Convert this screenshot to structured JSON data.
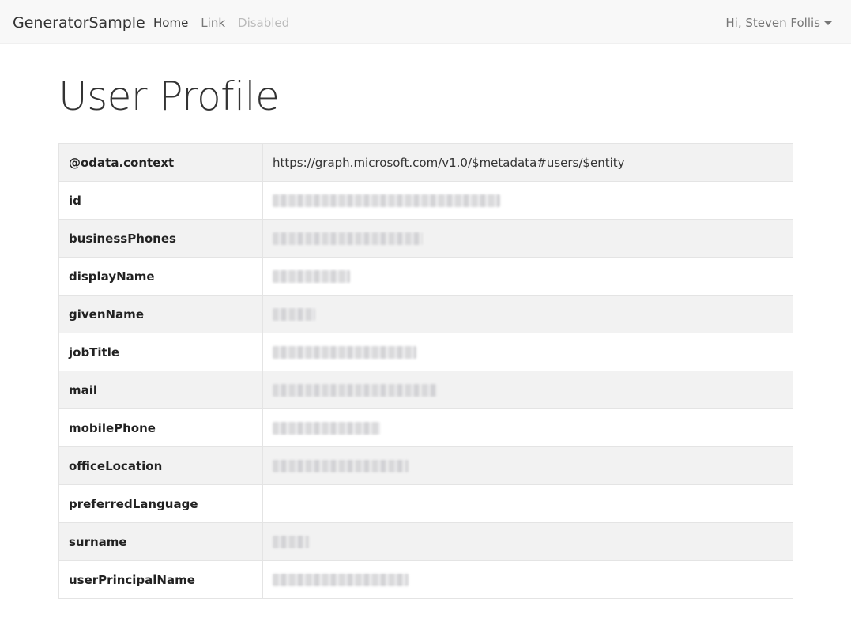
{
  "navbar": {
    "brand": "GeneratorSample",
    "links": [
      {
        "label": "Home",
        "state": "active"
      },
      {
        "label": "Link",
        "state": "normal"
      },
      {
        "label": "Disabled",
        "state": "disabled"
      }
    ],
    "user_greeting": "Hi, Steven Follis"
  },
  "page": {
    "title": "User Profile"
  },
  "profile": {
    "rows": [
      {
        "key": "@odata.context",
        "value": "https://graph.microsoft.com/v1.0/$metadata#users/$entity",
        "redacted": false
      },
      {
        "key": "id",
        "value": "",
        "redacted": true
      },
      {
        "key": "businessPhones",
        "value": "",
        "redacted": true
      },
      {
        "key": "displayName",
        "value": "",
        "redacted": true
      },
      {
        "key": "givenName",
        "value": "",
        "redacted": true
      },
      {
        "key": "jobTitle",
        "value": "",
        "redacted": true
      },
      {
        "key": "mail",
        "value": "",
        "redacted": true
      },
      {
        "key": "mobilePhone",
        "value": "",
        "redacted": true
      },
      {
        "key": "officeLocation",
        "value": "",
        "redacted": true
      },
      {
        "key": "preferredLanguage",
        "value": "",
        "redacted": false
      },
      {
        "key": "surname",
        "value": "",
        "redacted": true
      },
      {
        "key": "userPrincipalName",
        "value": "",
        "redacted": true
      }
    ]
  }
}
